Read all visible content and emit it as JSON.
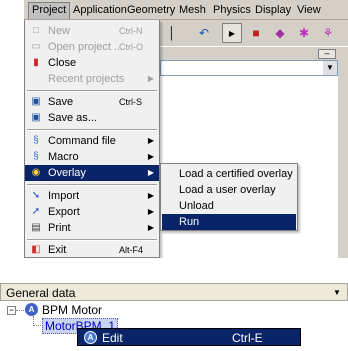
{
  "menubar": {
    "items": [
      "Project",
      "Application",
      "Geometry",
      "Mesh",
      "Physics",
      "Display",
      "View"
    ]
  },
  "project_menu": {
    "new": {
      "label": "New",
      "shortcut": "Ctrl-N"
    },
    "open": {
      "label": "Open project ...",
      "shortcut": "Ctrl-O"
    },
    "close": {
      "label": "Close"
    },
    "recent": {
      "label": "Recent projects"
    },
    "save": {
      "label": "Save",
      "shortcut": "Ctrl-S"
    },
    "save_as": {
      "label": "Save as..."
    },
    "command_file": {
      "label": "Command file"
    },
    "macro": {
      "label": "Macro"
    },
    "overlay": {
      "label": "Overlay"
    },
    "import": {
      "label": "Import"
    },
    "export": {
      "label": "Export"
    },
    "print": {
      "label": "Print"
    },
    "exit": {
      "label": "Exit",
      "shortcut": "Alt-F4"
    }
  },
  "overlay_submenu": {
    "items": [
      "Load a certified overlay",
      "Load a user overlay",
      "Unload",
      "Run"
    ],
    "selected": "Run"
  },
  "general_data": {
    "title": "General data",
    "tree": {
      "root_label": "BPM Motor",
      "child_label": "MotorBPM_1"
    },
    "context_menu": {
      "edit_label": "Edit",
      "edit_shortcut": "Ctrl-E"
    }
  },
  "colors": {
    "highlight": "#0a246a",
    "menu_bg": "#f0f0f0",
    "chrome": "#d4d0c8"
  }
}
